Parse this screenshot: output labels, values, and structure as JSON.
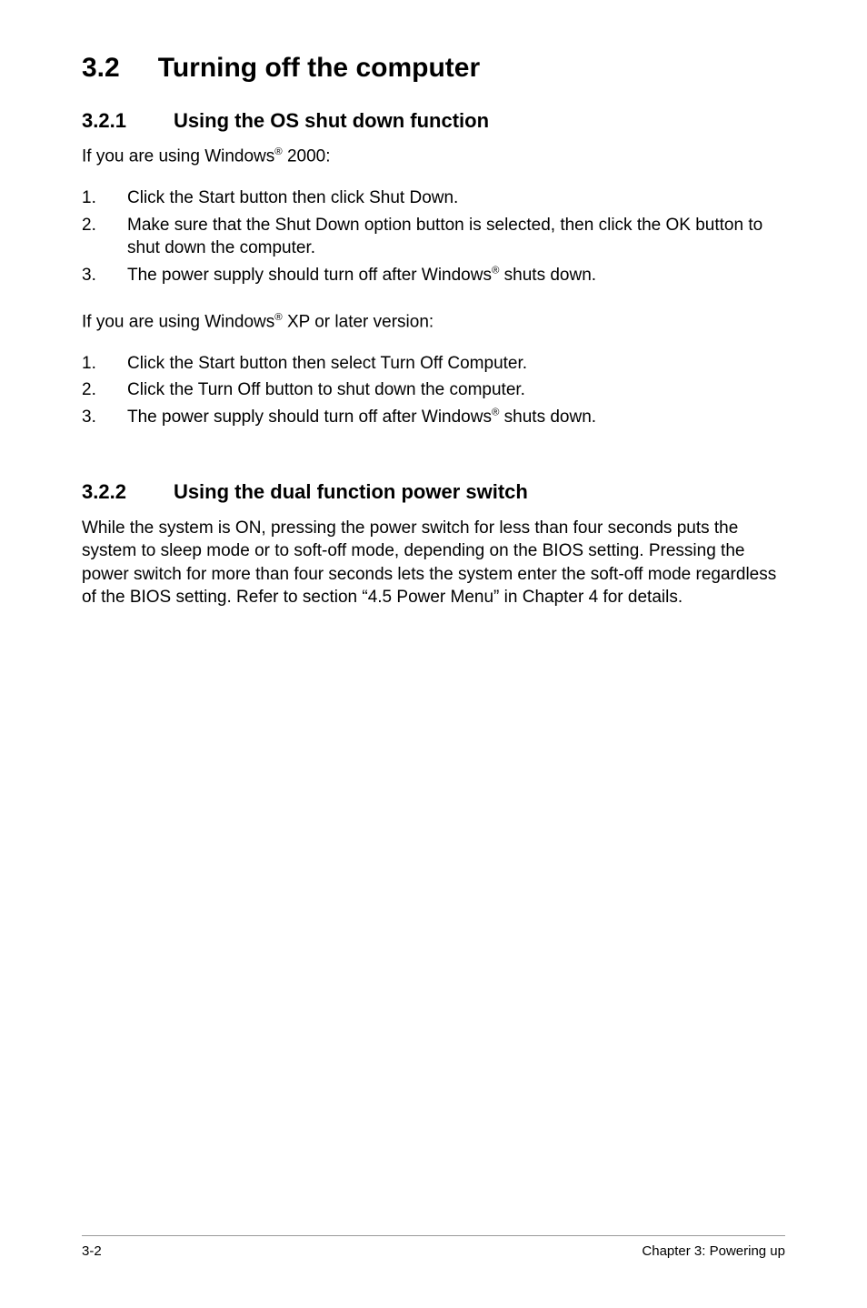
{
  "section": {
    "number": "3.2",
    "title": "Turning off the computer"
  },
  "sub1": {
    "number": "3.2.1",
    "title": "Using the OS shut down function",
    "intro_prefix": "If you are using Windows",
    "intro_suffix": " 2000:",
    "steps": [
      {
        "n": "1.",
        "text": "Click the Start button then click Shut Down."
      },
      {
        "n": "2.",
        "text": "Make sure that the Shut Down option button is selected, then click the OK button to shut down the computer."
      },
      {
        "n": "3.",
        "prefix": "The power supply should turn off after Windows",
        "suffix": " shuts down."
      }
    ],
    "intro2_prefix": "If you are using Windows",
    "intro2_suffix": " XP or later version:",
    "steps2": [
      {
        "n": "1.",
        "text": "Click the Start button then select Turn Off Computer."
      },
      {
        "n": "2.",
        "text": "Click the Turn Off button to shut down the computer."
      },
      {
        "n": "3.",
        "prefix": "The power supply should turn off after Windows",
        "suffix": " shuts down."
      }
    ]
  },
  "sub2": {
    "number": "3.2.2",
    "title": "Using the dual function power switch",
    "body": "While the system is ON, pressing the power switch for less than four seconds puts the system to sleep mode or to soft-off mode, depending on the BIOS setting. Pressing the power switch for more than four seconds lets the system enter the soft-off mode regardless of the BIOS setting. Refer to section  “4.5  Power Menu” in Chapter 4 for details."
  },
  "reg": "®",
  "footer": {
    "left": "3-2",
    "right": "Chapter 3: Powering up"
  }
}
